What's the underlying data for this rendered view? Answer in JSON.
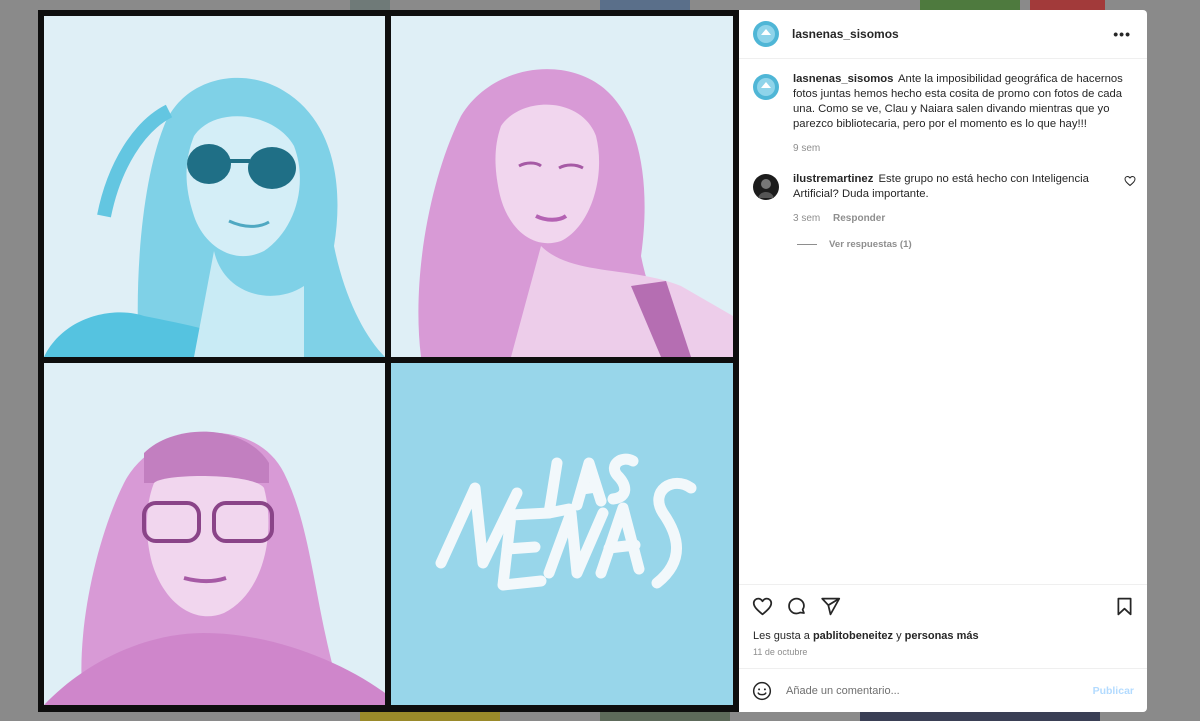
{
  "colors": {
    "cyan_tint": "#99d8ea",
    "pink_tint": "#e2a6dd",
    "pale_bg": "#dceef6",
    "logo_bg": "#98d6ea"
  },
  "post": {
    "images": [
      {
        "name": "photo-woman-sunglasses",
        "tint": "cyan"
      },
      {
        "name": "photo-woman-eyes-closed",
        "tint": "pink"
      },
      {
        "name": "photo-woman-glasses",
        "tint": "pink"
      },
      {
        "name": "logo-las-nenas",
        "text": "LAS NENAS"
      }
    ]
  },
  "sidebar": {
    "header": {
      "username": "lasnenas_sisomos",
      "more_label": "•••"
    },
    "comments": [
      {
        "username": "lasnenas_sisomos",
        "text": "Ante la imposibilidad geográfica de hacernos fotos juntas hemos hecho esta cosita de promo con fotos de cada una. Como se ve, Clau y Naiara salen divando mientras que yo parezco bibliotecaria, pero por el momento es lo que hay!!!",
        "time": "9 sem"
      },
      {
        "username": "ilustremartinez",
        "text": "Este grupo no está hecho con Inteligencia Artificial? Duda importante.",
        "time": "3 sem",
        "reply_label": "Responder",
        "view_replies": "Ver respuestas (1)"
      }
    ],
    "likes": {
      "prefix": "Les gusta a",
      "user": "pablitobeneitez",
      "connector": "y",
      "suffix": "personas más"
    },
    "date": "11 de octubre",
    "add_comment": {
      "placeholder": "Añade un comentario...",
      "publish_label": "Publicar"
    }
  }
}
